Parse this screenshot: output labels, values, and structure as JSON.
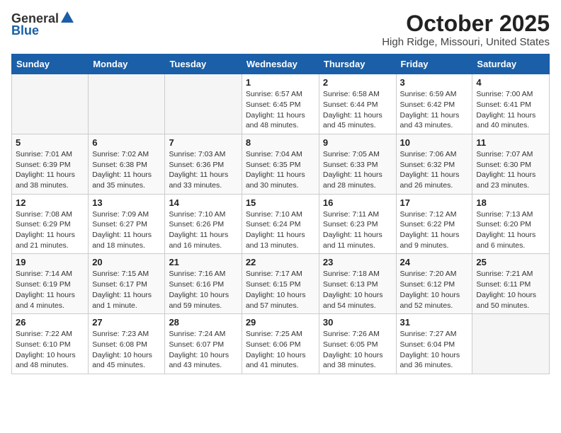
{
  "header": {
    "logo_general": "General",
    "logo_blue": "Blue",
    "month": "October 2025",
    "location": "High Ridge, Missouri, United States"
  },
  "weekdays": [
    "Sunday",
    "Monday",
    "Tuesday",
    "Wednesday",
    "Thursday",
    "Friday",
    "Saturday"
  ],
  "weeks": [
    [
      {
        "day": "",
        "info": ""
      },
      {
        "day": "",
        "info": ""
      },
      {
        "day": "",
        "info": ""
      },
      {
        "day": "1",
        "info": "Sunrise: 6:57 AM\nSunset: 6:45 PM\nDaylight: 11 hours\nand 48 minutes."
      },
      {
        "day": "2",
        "info": "Sunrise: 6:58 AM\nSunset: 6:44 PM\nDaylight: 11 hours\nand 45 minutes."
      },
      {
        "day": "3",
        "info": "Sunrise: 6:59 AM\nSunset: 6:42 PM\nDaylight: 11 hours\nand 43 minutes."
      },
      {
        "day": "4",
        "info": "Sunrise: 7:00 AM\nSunset: 6:41 PM\nDaylight: 11 hours\nand 40 minutes."
      }
    ],
    [
      {
        "day": "5",
        "info": "Sunrise: 7:01 AM\nSunset: 6:39 PM\nDaylight: 11 hours\nand 38 minutes."
      },
      {
        "day": "6",
        "info": "Sunrise: 7:02 AM\nSunset: 6:38 PM\nDaylight: 11 hours\nand 35 minutes."
      },
      {
        "day": "7",
        "info": "Sunrise: 7:03 AM\nSunset: 6:36 PM\nDaylight: 11 hours\nand 33 minutes."
      },
      {
        "day": "8",
        "info": "Sunrise: 7:04 AM\nSunset: 6:35 PM\nDaylight: 11 hours\nand 30 minutes."
      },
      {
        "day": "9",
        "info": "Sunrise: 7:05 AM\nSunset: 6:33 PM\nDaylight: 11 hours\nand 28 minutes."
      },
      {
        "day": "10",
        "info": "Sunrise: 7:06 AM\nSunset: 6:32 PM\nDaylight: 11 hours\nand 26 minutes."
      },
      {
        "day": "11",
        "info": "Sunrise: 7:07 AM\nSunset: 6:30 PM\nDaylight: 11 hours\nand 23 minutes."
      }
    ],
    [
      {
        "day": "12",
        "info": "Sunrise: 7:08 AM\nSunset: 6:29 PM\nDaylight: 11 hours\nand 21 minutes."
      },
      {
        "day": "13",
        "info": "Sunrise: 7:09 AM\nSunset: 6:27 PM\nDaylight: 11 hours\nand 18 minutes."
      },
      {
        "day": "14",
        "info": "Sunrise: 7:10 AM\nSunset: 6:26 PM\nDaylight: 11 hours\nand 16 minutes."
      },
      {
        "day": "15",
        "info": "Sunrise: 7:10 AM\nSunset: 6:24 PM\nDaylight: 11 hours\nand 13 minutes."
      },
      {
        "day": "16",
        "info": "Sunrise: 7:11 AM\nSunset: 6:23 PM\nDaylight: 11 hours\nand 11 minutes."
      },
      {
        "day": "17",
        "info": "Sunrise: 7:12 AM\nSunset: 6:22 PM\nDaylight: 11 hours\nand 9 minutes."
      },
      {
        "day": "18",
        "info": "Sunrise: 7:13 AM\nSunset: 6:20 PM\nDaylight: 11 hours\nand 6 minutes."
      }
    ],
    [
      {
        "day": "19",
        "info": "Sunrise: 7:14 AM\nSunset: 6:19 PM\nDaylight: 11 hours\nand 4 minutes."
      },
      {
        "day": "20",
        "info": "Sunrise: 7:15 AM\nSunset: 6:17 PM\nDaylight: 11 hours\nand 1 minute."
      },
      {
        "day": "21",
        "info": "Sunrise: 7:16 AM\nSunset: 6:16 PM\nDaylight: 10 hours\nand 59 minutes."
      },
      {
        "day": "22",
        "info": "Sunrise: 7:17 AM\nSunset: 6:15 PM\nDaylight: 10 hours\nand 57 minutes."
      },
      {
        "day": "23",
        "info": "Sunrise: 7:18 AM\nSunset: 6:13 PM\nDaylight: 10 hours\nand 54 minutes."
      },
      {
        "day": "24",
        "info": "Sunrise: 7:20 AM\nSunset: 6:12 PM\nDaylight: 10 hours\nand 52 minutes."
      },
      {
        "day": "25",
        "info": "Sunrise: 7:21 AM\nSunset: 6:11 PM\nDaylight: 10 hours\nand 50 minutes."
      }
    ],
    [
      {
        "day": "26",
        "info": "Sunrise: 7:22 AM\nSunset: 6:10 PM\nDaylight: 10 hours\nand 48 minutes."
      },
      {
        "day": "27",
        "info": "Sunrise: 7:23 AM\nSunset: 6:08 PM\nDaylight: 10 hours\nand 45 minutes."
      },
      {
        "day": "28",
        "info": "Sunrise: 7:24 AM\nSunset: 6:07 PM\nDaylight: 10 hours\nand 43 minutes."
      },
      {
        "day": "29",
        "info": "Sunrise: 7:25 AM\nSunset: 6:06 PM\nDaylight: 10 hours\nand 41 minutes."
      },
      {
        "day": "30",
        "info": "Sunrise: 7:26 AM\nSunset: 6:05 PM\nDaylight: 10 hours\nand 38 minutes."
      },
      {
        "day": "31",
        "info": "Sunrise: 7:27 AM\nSunset: 6:04 PM\nDaylight: 10 hours\nand 36 minutes."
      },
      {
        "day": "",
        "info": ""
      }
    ]
  ]
}
